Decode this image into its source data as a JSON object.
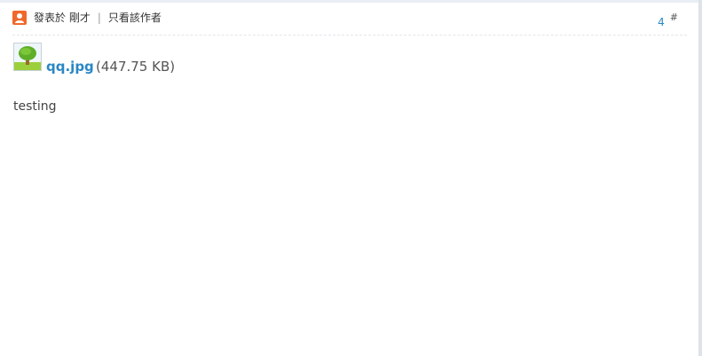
{
  "post": {
    "posted_label": "發表於 剛才",
    "separator": "|",
    "only_author_label": "只看該作者",
    "floor_number": "4",
    "floor_symbol": "#",
    "attachment": {
      "filename": "qq.jpg",
      "size": "(447.75 KB)",
      "icon": "image-file-icon"
    },
    "content": "testing"
  },
  "colors": {
    "link": "#2a87c5",
    "author_icon": "#f0682a"
  }
}
